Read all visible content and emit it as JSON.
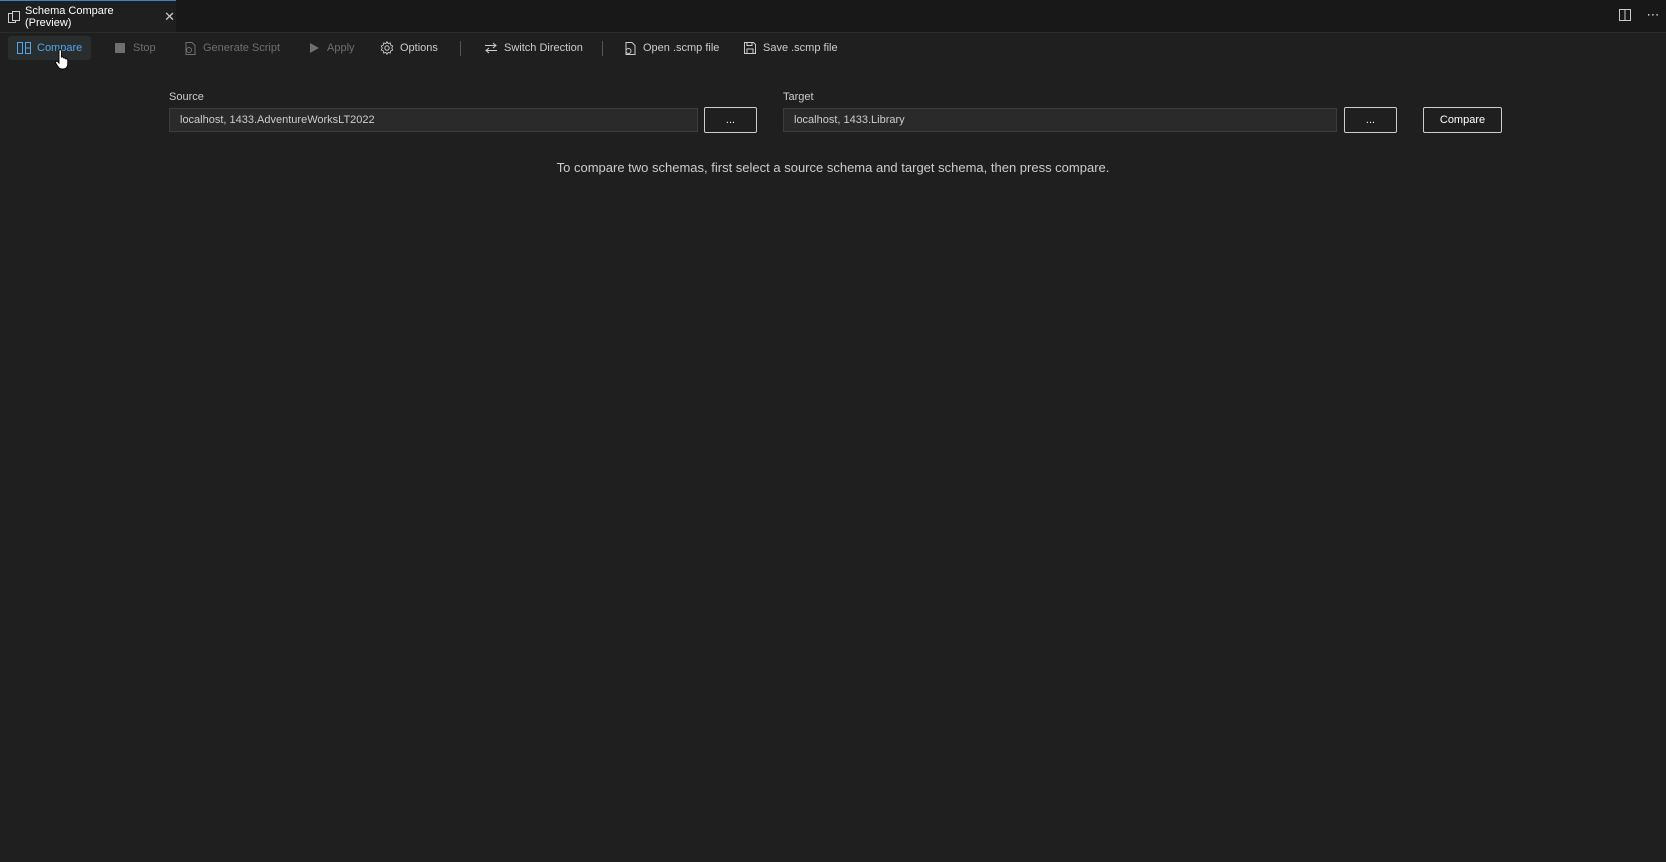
{
  "tab": {
    "title": "Schema Compare (Preview)",
    "close_glyph": "✕",
    "icon": "schema-compare-icon"
  },
  "tab_actions": {
    "split_icon": "split-editor-icon",
    "more_glyph": "⋯"
  },
  "toolbar": {
    "compare_label": "Compare",
    "stop_label": "Stop",
    "generate_script_label": "Generate Script",
    "apply_label": "Apply",
    "options_label": "Options",
    "switch_direction_label": "Switch Direction",
    "open_scmp_label": "Open .scmp file",
    "save_scmp_label": "Save .scmp file"
  },
  "source": {
    "label": "Source",
    "value": "localhost, 1433.AdventureWorksLT2022",
    "browse_label": "..."
  },
  "target": {
    "label": "Target",
    "value": "localhost, 1433.Library",
    "browse_label": "..."
  },
  "compare_button_label": "Compare",
  "hint": "To compare two schemas, first select a source schema and target schema, then press compare.",
  "colors": {
    "accent": "#4fa6ec",
    "background": "#1f1f1f",
    "tab_accent": "#3b82c4"
  }
}
